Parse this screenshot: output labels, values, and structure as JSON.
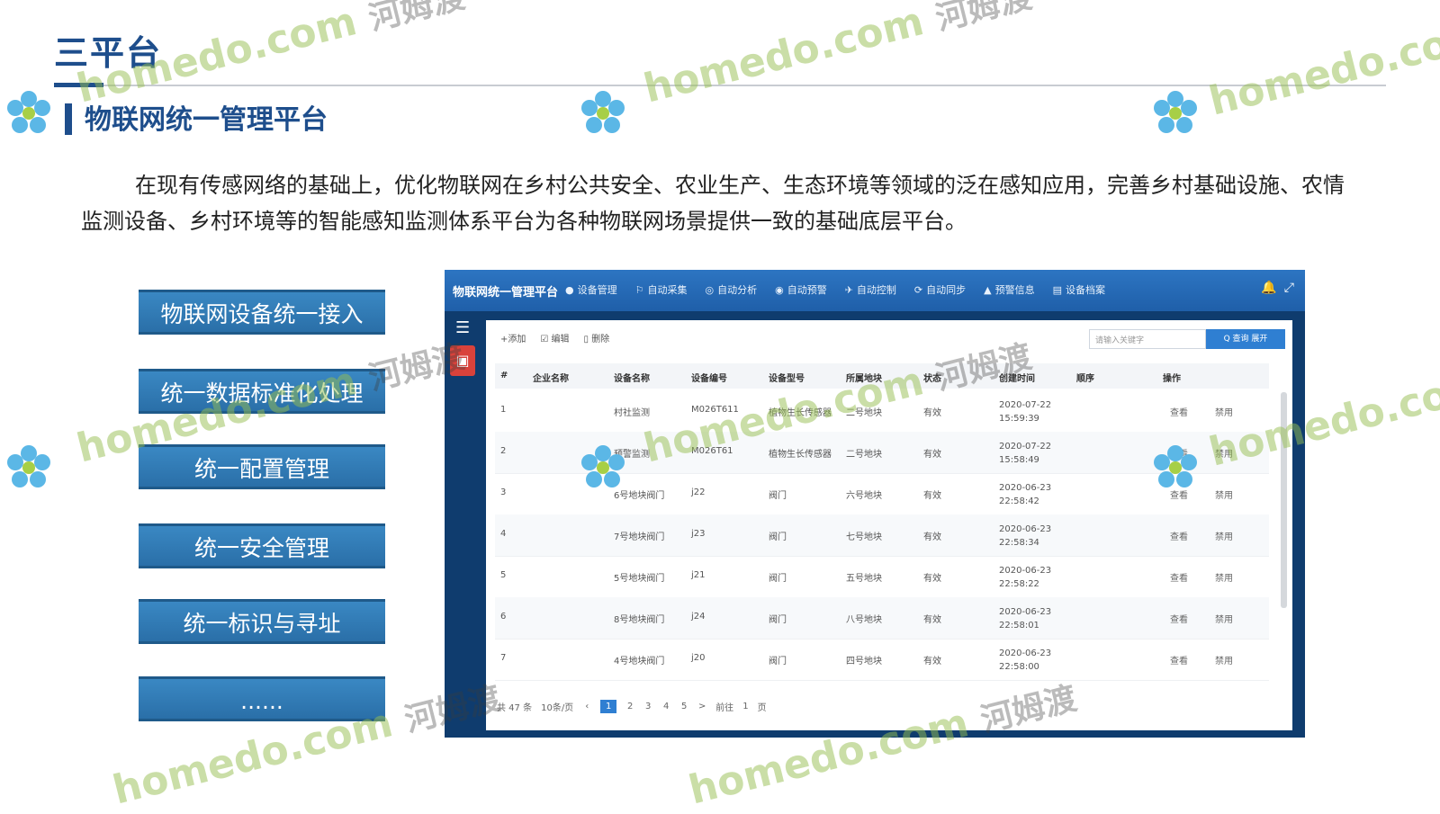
{
  "slide": {
    "title": "三平台",
    "section_title": "物联网统一管理平台",
    "intro": "在现有传感网络的基础上，优化物联网在乡村公共安全、农业生产、生态环境等领域的泛在感知应用，完善乡村基础设施、农情监测设备、乡村环境等的智能感知监测体系平台为各种物联网场景提供一致的基础底层平台。"
  },
  "features": [
    "物联网设备统一接入",
    "统一数据标准化处理",
    "统一配置管理",
    "统一安全管理",
    "统一标识与寻址",
    "......"
  ],
  "app": {
    "title": "物联网统一管理平台",
    "nav": [
      {
        "label": "设备管理",
        "icon": "dot-icon"
      },
      {
        "label": "自动采集",
        "icon": "flag-icon"
      },
      {
        "label": "自动分析",
        "icon": "gauge-icon"
      },
      {
        "label": "自动预警",
        "icon": "alert-icon"
      },
      {
        "label": "自动控制",
        "icon": "plane-icon"
      },
      {
        "label": "自动同步",
        "icon": "sync-icon"
      },
      {
        "label": "预警信息",
        "icon": "warning-icon"
      },
      {
        "label": "设备档案",
        "icon": "file-icon"
      }
    ],
    "toolbar": {
      "add": "+添加",
      "edit": "☑ 编辑",
      "delete": "▯ 删除"
    },
    "search": {
      "placeholder": "请输入关键字",
      "button": "Q 查询  展开"
    },
    "table": {
      "headers": [
        "#",
        "企业名称",
        "设备名称",
        "设备编号",
        "设备型号",
        "所属地块",
        "状态",
        "创建时间",
        "顺序",
        "操作"
      ],
      "rows": [
        {
          "no": "1",
          "name": "村社监测",
          "code": "M026T611",
          "model": "植物生长传感器",
          "plot": "二号地块",
          "status": "有效",
          "time": "2020-07-22 15:59:39",
          "edit": "查看",
          "disable": "禁用"
        },
        {
          "no": "2",
          "name": "预警监测",
          "code": "M026T61",
          "model": "植物生长传感器",
          "plot": "二号地块",
          "status": "有效",
          "time": "2020-07-22 15:58:49",
          "edit": "查看",
          "disable": "禁用"
        },
        {
          "no": "3",
          "name": "6号地块阀门",
          "code": "j22",
          "model": "阀门",
          "plot": "六号地块",
          "status": "有效",
          "time": "2020-06-23 22:58:42",
          "edit": "查看",
          "disable": "禁用"
        },
        {
          "no": "4",
          "name": "7号地块阀门",
          "code": "j23",
          "model": "阀门",
          "plot": "七号地块",
          "status": "有效",
          "time": "2020-06-23 22:58:34",
          "edit": "查看",
          "disable": "禁用"
        },
        {
          "no": "5",
          "name": "5号地块阀门",
          "code": "j21",
          "model": "阀门",
          "plot": "五号地块",
          "status": "有效",
          "time": "2020-06-23 22:58:22",
          "edit": "查看",
          "disable": "禁用"
        },
        {
          "no": "6",
          "name": "8号地块阀门",
          "code": "j24",
          "model": "阀门",
          "plot": "八号地块",
          "status": "有效",
          "time": "2020-06-23 22:58:01",
          "edit": "查看",
          "disable": "禁用"
        },
        {
          "no": "7",
          "name": "4号地块阀门",
          "code": "j20",
          "model": "阀门",
          "plot": "四号地块",
          "status": "有效",
          "time": "2020-06-23 22:58:00",
          "edit": "查看",
          "disable": "禁用"
        }
      ]
    },
    "pager": {
      "total": "共 47 条",
      "size": "10条/页",
      "pages": [
        "1",
        "2",
        "3",
        "4",
        "5"
      ],
      "next": ">",
      "goto": "前往",
      "page": "1",
      "unit": "页"
    }
  },
  "watermark": {
    "text": "homedo.com",
    "cn": "河姆渡"
  },
  "colors": {
    "title": "#1e4e8c",
    "feature": "#2a6fa8",
    "app_header": "#2d75c2",
    "danger": "#d9423b"
  }
}
